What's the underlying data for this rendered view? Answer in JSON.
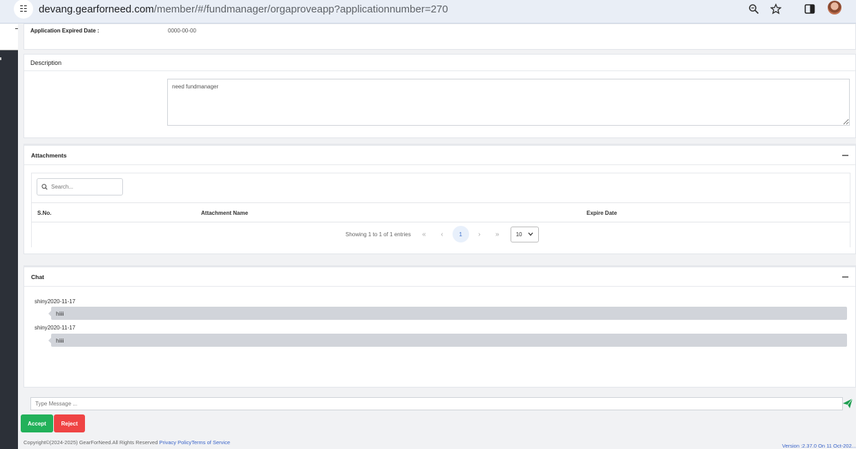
{
  "browser": {
    "url_host": "devang.gearforneed.com",
    "url_path": "/member/#/fundmanager/orgaproveapp?applicationnumber=270"
  },
  "application": {
    "expired_label": "Application Expired Date :",
    "expired_value": "0000-00-00"
  },
  "description": {
    "title": "Description",
    "text": "need fundmanager"
  },
  "attachments": {
    "title": "Attachments",
    "search_placeholder": "Search...",
    "columns": [
      "S.No.",
      "Attachment Name",
      "Expire Date"
    ],
    "pagination": {
      "info": "Showing 1 to 1 of 1 entries",
      "first": "«",
      "prev": "‹",
      "current_page": "1",
      "next": "›",
      "last": "»",
      "page_size": "10"
    }
  },
  "chat": {
    "title": "Chat",
    "messages": [
      {
        "user": "shiny",
        "date": "2020-11-17",
        "text": "hiiii"
      },
      {
        "user": "shiny",
        "date": "2020-11-17",
        "text": "hiiii"
      }
    ],
    "input_placeholder": "Type Message ..."
  },
  "actions": {
    "accept_label": "Accept",
    "reject_label": "Reject"
  },
  "footer": {
    "copyright": "Copyright©(2024-2025) GearForNeed.All Rights Reserved ",
    "privacy": "Privacy Policy",
    "terms": "Terms of Service",
    "version": "Version :2.37.0 On 11 Oct-202..."
  },
  "colors": {
    "accept": "#22b15a",
    "reject": "#ef4444",
    "link": "#3a64c8",
    "sidebar": "#2c3038"
  }
}
